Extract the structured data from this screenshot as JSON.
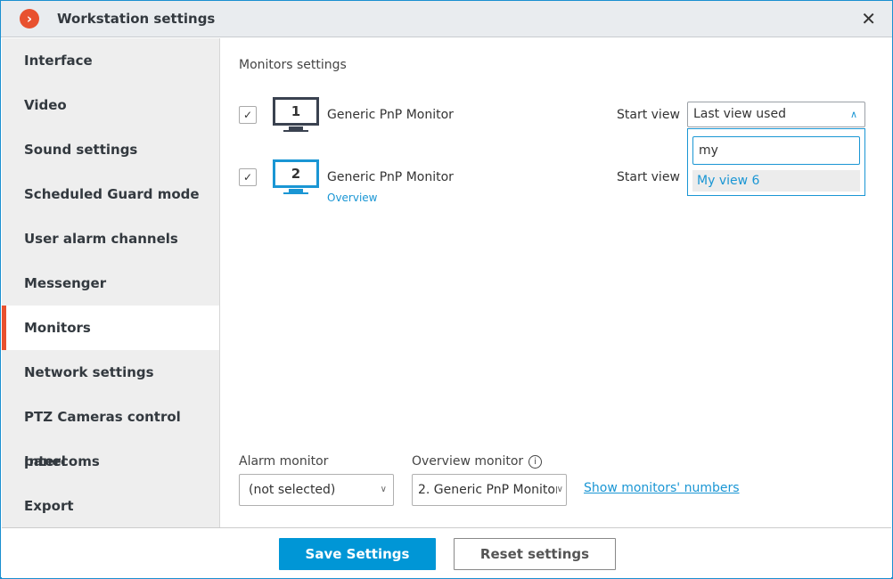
{
  "window": {
    "title": "Workstation settings",
    "close_icon": "close-icon",
    "accent": "#e8512f",
    "primary": "#0096d6"
  },
  "sidebar": {
    "items": [
      {
        "label": "Interface"
      },
      {
        "label": "Video"
      },
      {
        "label": "Sound settings"
      },
      {
        "label": "Scheduled Guard mode"
      },
      {
        "label": "User alarm channels"
      },
      {
        "label": "Messenger"
      },
      {
        "label": "Monitors",
        "active": true
      },
      {
        "label": "Network settings"
      },
      {
        "label": "PTZ Cameras control panel"
      },
      {
        "label": "Intercoms"
      },
      {
        "label": "Export"
      }
    ]
  },
  "main": {
    "heading": "Monitors settings",
    "monitors": [
      {
        "number": "1",
        "name": "Generic PnP Monitor",
        "checked": true,
        "start_view_label": "Start view",
        "start_view": "Last view used"
      },
      {
        "number": "2",
        "name": "Generic PnP Monitor",
        "checked": true,
        "sub_label": "Overview",
        "start_view_label": "Start view"
      }
    ],
    "dropdown": {
      "search_value": "my",
      "options": [
        "My view 6"
      ]
    },
    "alarm_monitor": {
      "label": "Alarm monitor",
      "value": "(not selected)"
    },
    "overview_monitor": {
      "label": "Overview monitor",
      "value": "2. Generic PnP Monitor"
    },
    "show_numbers_link": "Show monitors' numbers"
  },
  "footer": {
    "save_label": "Save Settings",
    "reset_label": "Reset settings"
  }
}
